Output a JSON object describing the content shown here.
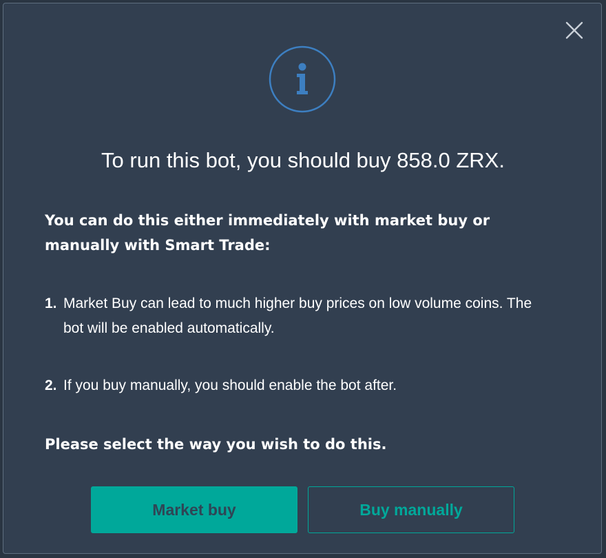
{
  "dialog": {
    "close_icon": "close-icon",
    "info_icon": "info-icon",
    "title": "To run this bot, you should buy 858.0 ZRX.",
    "intro": "You can do this either immediately with market buy or manually with Smart Trade:",
    "steps": [
      {
        "number": "1.",
        "text": "Market Buy can lead to much higher buy prices on low volume coins. The bot will be enabled automatically."
      },
      {
        "number": "2.",
        "text": "If you buy manually, you should enable the bot after."
      }
    ],
    "prompt": "Please select the way you wish to do this.",
    "buttons": {
      "market_buy": "Market buy",
      "buy_manually": "Buy manually"
    }
  },
  "colors": {
    "background": "#323f50",
    "accent": "#00a89a",
    "info_blue": "#3d7fc1"
  }
}
